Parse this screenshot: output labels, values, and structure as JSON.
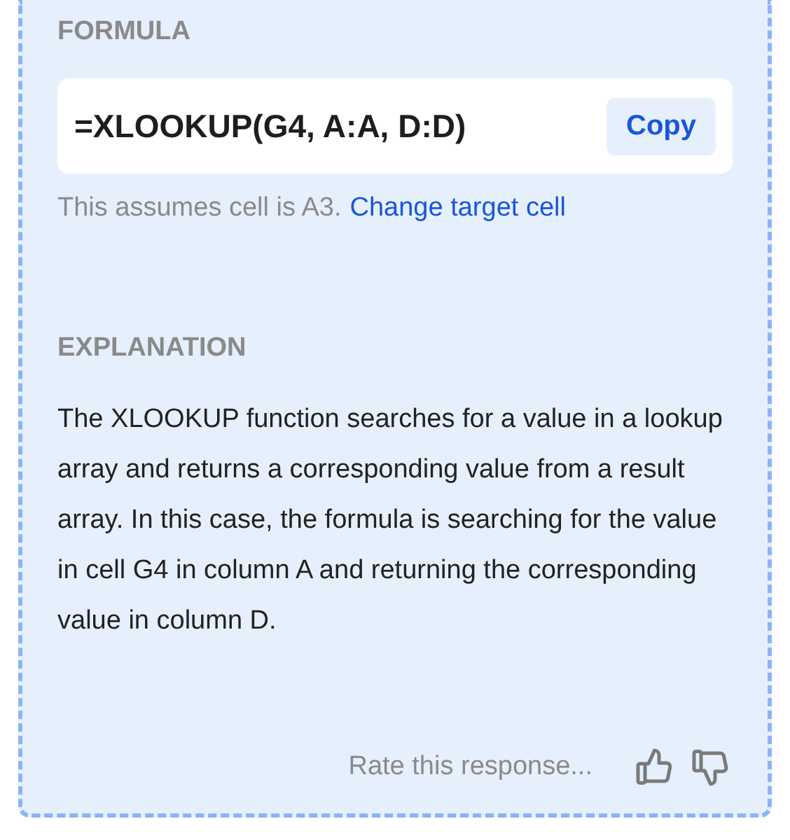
{
  "formula": {
    "heading": "FORMULA",
    "value": "=XLOOKUP(G4, A:A, D:D)",
    "copy_button": "Copy",
    "hint": "This assumes cell is A3.",
    "hint_link": "Change target cell"
  },
  "explanation": {
    "heading": "EXPLANATION",
    "text": "The XLOOKUP function searches for a value in a lookup array and returns a corresponding value from a result array. In this case, the formula is searching for the value in cell G4 in column A and returning the corresponding value in column D."
  },
  "feedback": {
    "prompt": "Rate this response..."
  }
}
